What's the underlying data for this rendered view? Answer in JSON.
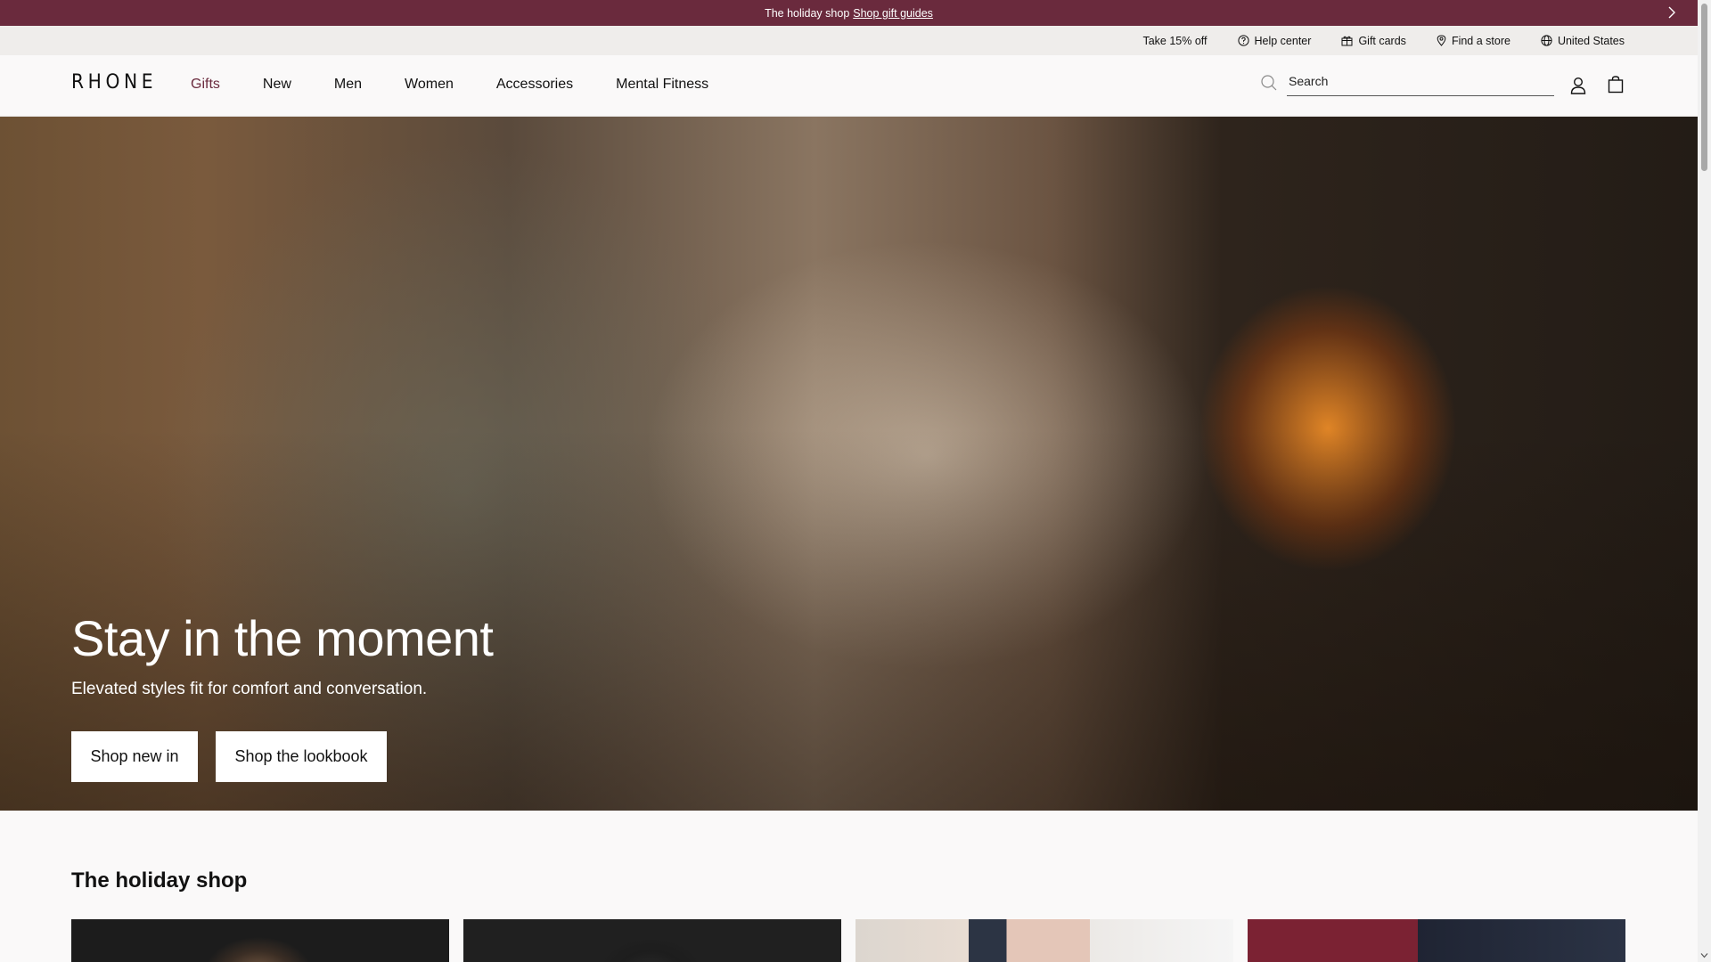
{
  "announcement": {
    "text": "The holiday shop",
    "link": "Shop gift guides"
  },
  "utility": {
    "items": [
      {
        "label": "Take 15% off",
        "icon": ""
      },
      {
        "label": "Help center",
        "icon": "question-circle-icon"
      },
      {
        "label": "Gift cards",
        "icon": "gift-icon"
      },
      {
        "label": "Find a store",
        "icon": "location-pin-icon"
      },
      {
        "label": "United States",
        "icon": "globe-icon"
      }
    ]
  },
  "header": {
    "logo": "RHONE",
    "nav": [
      "Gifts",
      "New",
      "Men",
      "Women",
      "Accessories",
      "Mental Fitness"
    ],
    "active_nav": "Gifts",
    "search": {
      "placeholder": "Search",
      "value": ""
    }
  },
  "hero": {
    "title": "Stay in the moment",
    "subtitle": "Elevated styles fit for comfort and conversation.",
    "buttons": [
      "Shop new in",
      "Shop the lookbook"
    ]
  },
  "holiday": {
    "title": "The holiday shop"
  },
  "colors": {
    "announce_bg": "#6a2a3d",
    "active_nav": "#6a2a3d",
    "utility_bg": "#efedeb",
    "page_bg": "#faf9f9"
  }
}
